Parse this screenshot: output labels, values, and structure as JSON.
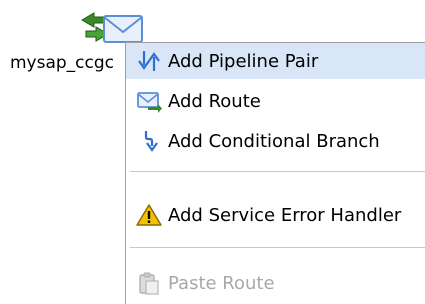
{
  "node": {
    "label": "mysap_ccgc",
    "icon": "pipeline-node-icon"
  },
  "context_menu": {
    "items": [
      {
        "label": "Add Pipeline Pair",
        "icon": "pipeline-pair-icon",
        "state": "highlighted"
      },
      {
        "label": "Add Route",
        "icon": "route-icon",
        "state": "enabled"
      },
      {
        "label": "Add Conditional Branch",
        "icon": "conditional-branch-icon",
        "state": "enabled"
      },
      {
        "label": "Add Service Error Handler",
        "icon": "warning-icon",
        "state": "enabled"
      },
      {
        "label": "Paste Route",
        "icon": "paste-icon",
        "state": "disabled"
      }
    ]
  },
  "colors": {
    "highlight": "#d8e6f7",
    "disabled_text": "#a8a8a8",
    "arrow_green": "#3a8a2a",
    "envelope_blue": "#5b8fd6",
    "warning_yellow": "#f2c200"
  }
}
